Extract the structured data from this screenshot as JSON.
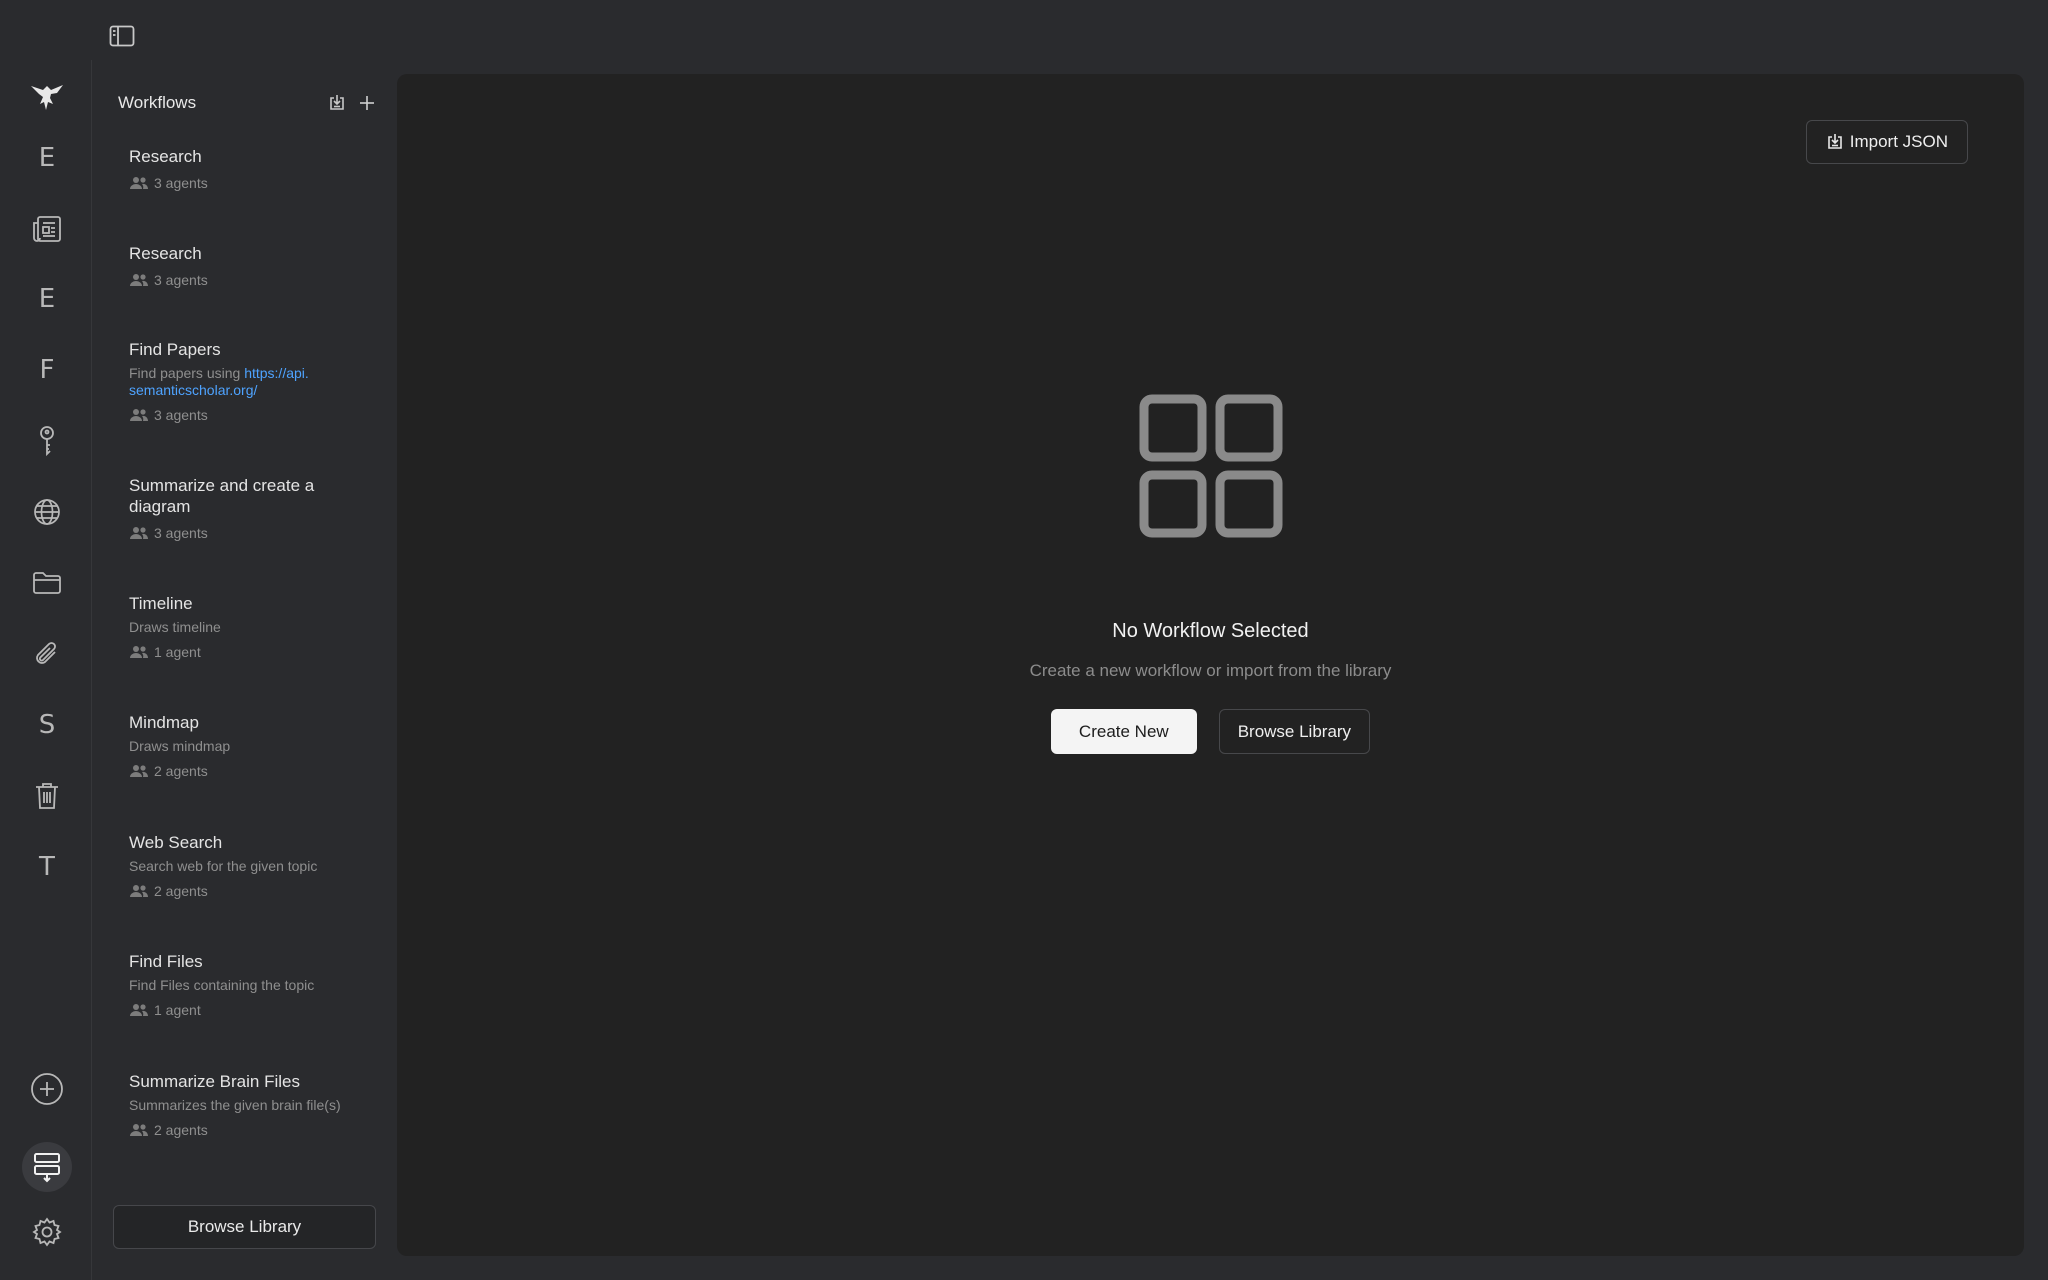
{
  "rail": {
    "letters": [
      "E",
      "E",
      "F",
      "S",
      "T"
    ]
  },
  "panel": {
    "title": "Workflows",
    "workflows": [
      {
        "title": "Research",
        "desc": "",
        "agents": "3 agents"
      },
      {
        "title": "Research",
        "desc": "",
        "agents": "3 agents"
      },
      {
        "title": "Find Papers",
        "desc_prefix": "Find papers using ",
        "desc_link": "https://api.semanticscholar.org/",
        "agents": "3 agents"
      },
      {
        "title": "Summarize and create a diagram",
        "desc": "",
        "agents": "3 agents"
      },
      {
        "title": "Timeline",
        "desc": "Draws timeline",
        "agents": "1 agent"
      },
      {
        "title": "Mindmap",
        "desc": "Draws mindmap",
        "agents": "2 agents"
      },
      {
        "title": "Web Search",
        "desc": "Search web for the given topic",
        "agents": "2 agents"
      },
      {
        "title": "Find Files",
        "desc": "Find Files containing the topic",
        "agents": "1 agent"
      },
      {
        "title": "Summarize Brain Files",
        "desc": "Summarizes the given brain file(s)",
        "agents": "2 agents"
      }
    ],
    "browse_library": "Browse Library"
  },
  "main": {
    "import_json": "Import JSON",
    "empty_title": "No Workflow Selected",
    "empty_subtitle": "Create a new workflow or import from the library",
    "create_new": "Create New",
    "browse_library": "Browse Library"
  },
  "colors": {
    "link": "#4ea3ff",
    "background": "#2a2b2e",
    "main_background": "#222222"
  }
}
